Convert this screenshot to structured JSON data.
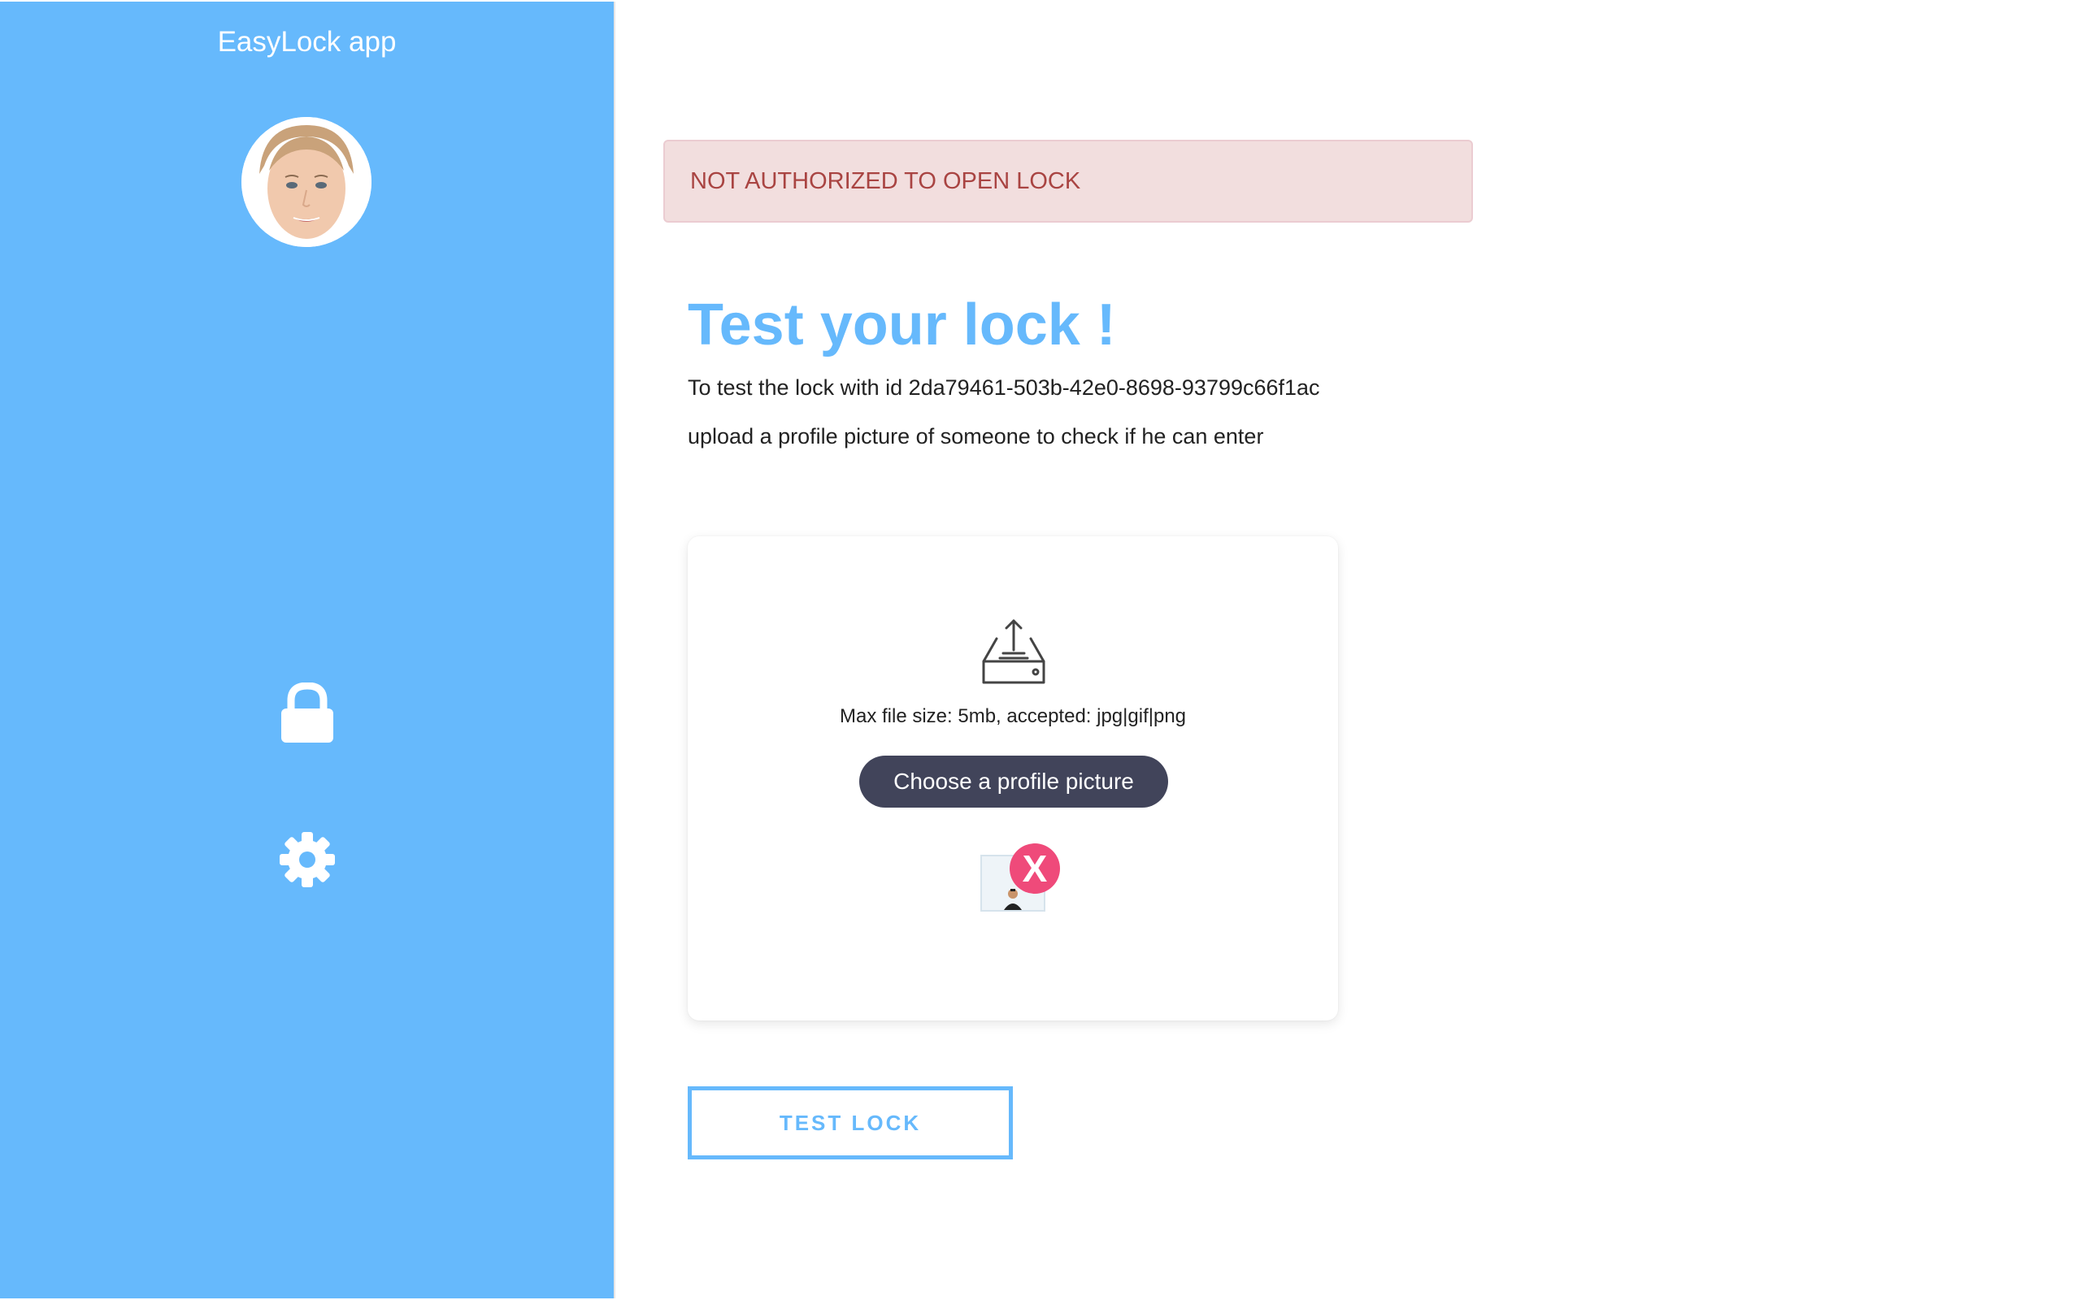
{
  "app": {
    "title": "EasyLock app"
  },
  "sidebar": {
    "avatar": "user-avatar",
    "nav": [
      {
        "icon": "lock-icon"
      },
      {
        "icon": "gear-icon"
      }
    ]
  },
  "alert": {
    "message": "NOT AUTHORIZED TO OPEN LOCK",
    "bg_color": "#f2dede",
    "text_color": "#a94442"
  },
  "main": {
    "title": "Test your lock !",
    "description_line1": "To test the lock with id 2da79461-503b-42e0-8698-93799c66f1ac",
    "description_line2": "upload a profile picture of someone to check if he can enter"
  },
  "upload": {
    "icon": "upload-tray-icon",
    "info": "Max file size: 5mb, accepted: jpg|gif|png",
    "button_label": "Choose a profile picture",
    "remove_label": "X"
  },
  "actions": {
    "test_label": "TEST LOCK"
  },
  "colors": {
    "accent": "#66b9fc",
    "dark_button": "#41445a",
    "remove": "#ef4a7a"
  }
}
